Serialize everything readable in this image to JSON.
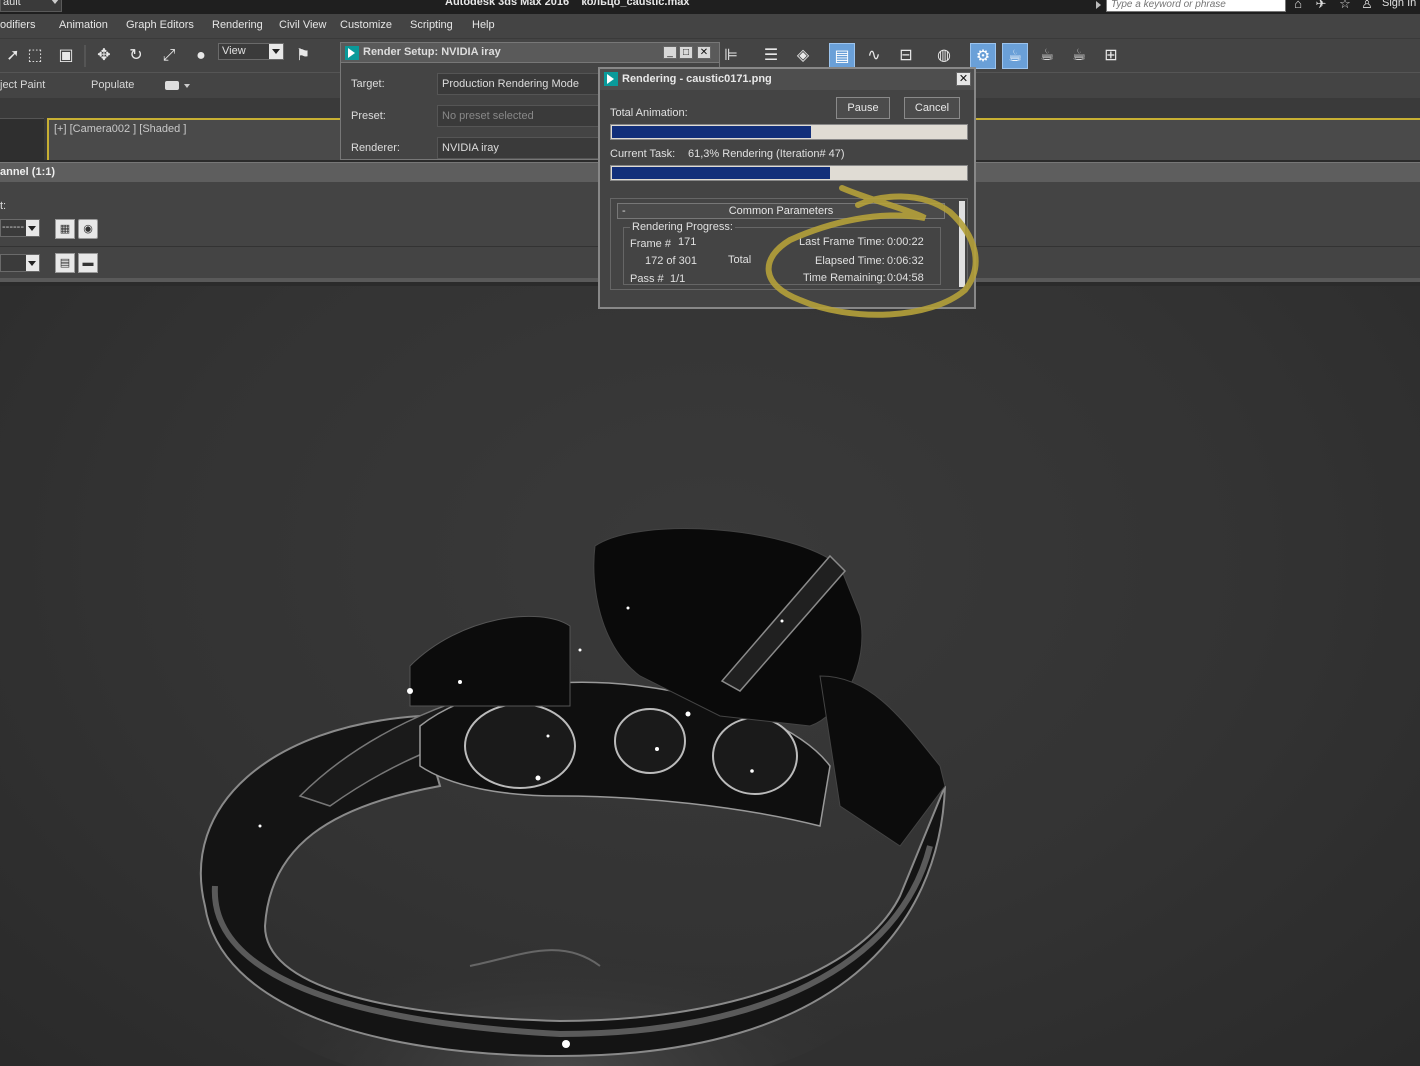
{
  "titlebar": {
    "workspace": "ault",
    "app_title": "Autodesk 3ds Max 2016    кольцо_caustic.max",
    "search_placeholder": "Type a keyword or phrase",
    "sign_in": "Sign In"
  },
  "menu": [
    "odifiers",
    "Animation",
    "Graph Editors",
    "Rendering",
    "Civil View",
    "Customize",
    "Scripting",
    "Help"
  ],
  "toolbar": {
    "view_dropdown": "View"
  },
  "ribbon": {
    "items": [
      "ject Paint",
      "Populate"
    ]
  },
  "viewport": {
    "label": "[+] [Camera002 ] [Shaded ]"
  },
  "frame_window": {
    "channel_label": "annel (1:1)",
    "t_label": "t:",
    "dd1_value": "------",
    "dd2_value": ""
  },
  "render_setup": {
    "title": "Render Setup: NVIDIA iray",
    "target_label": "Target:",
    "target_value": "Production Rendering Mode",
    "preset_label": "Preset:",
    "preset_value": "No preset selected",
    "renderer_label": "Renderer:",
    "renderer_value": "NVIDIA iray",
    "btn_min": "_",
    "btn_max": "□",
    "btn_close": "✕"
  },
  "rendering": {
    "title": "Rendering - caustic0171.png",
    "close": "✕",
    "pause": "Pause",
    "cancel": "Cancel",
    "total_animation_label": "Total Animation:",
    "total_progress": 0.56,
    "current_task_label": "Current Task:",
    "current_task_value": "61,3% Rendering (Iteration# 47)",
    "current_progress": 0.613,
    "common_params_minus": "-",
    "common_params_title": "Common Parameters",
    "progress_legend": "Rendering Progress:",
    "frame_label": "Frame #",
    "frame_value": "171",
    "of_text": "172 of 301",
    "total_text": "Total",
    "pass_label": "Pass #",
    "pass_value": "1/1",
    "last_frame_label": "Last Frame Time:",
    "last_frame_value": "0:00:22",
    "elapsed_label": "Elapsed Time:",
    "elapsed_value": "0:06:32",
    "remaining_label": "Time Remaining:",
    "remaining_value": "0:04:58"
  },
  "colors": {
    "progress_fill": "#122f7a",
    "annotation": "#b5a13a",
    "toolbar_active": "#6aa0d8"
  },
  "icons": [
    "select-icon",
    "region-select-icon",
    "window-crossing-icon",
    "move-icon",
    "rotate-icon",
    "scale-icon",
    "place-icon",
    "snap-icon",
    "align-icon",
    "layer-explorer-icon",
    "toggle-ribbon-icon",
    "curve-editor-icon",
    "schematic-view-icon",
    "material-editor-icon",
    "render-setup-icon",
    "rendered-frame-window-icon",
    "render-production-icon",
    "render-iterative-icon",
    "render-cloud-icon",
    "render-activeshade-icon"
  ]
}
